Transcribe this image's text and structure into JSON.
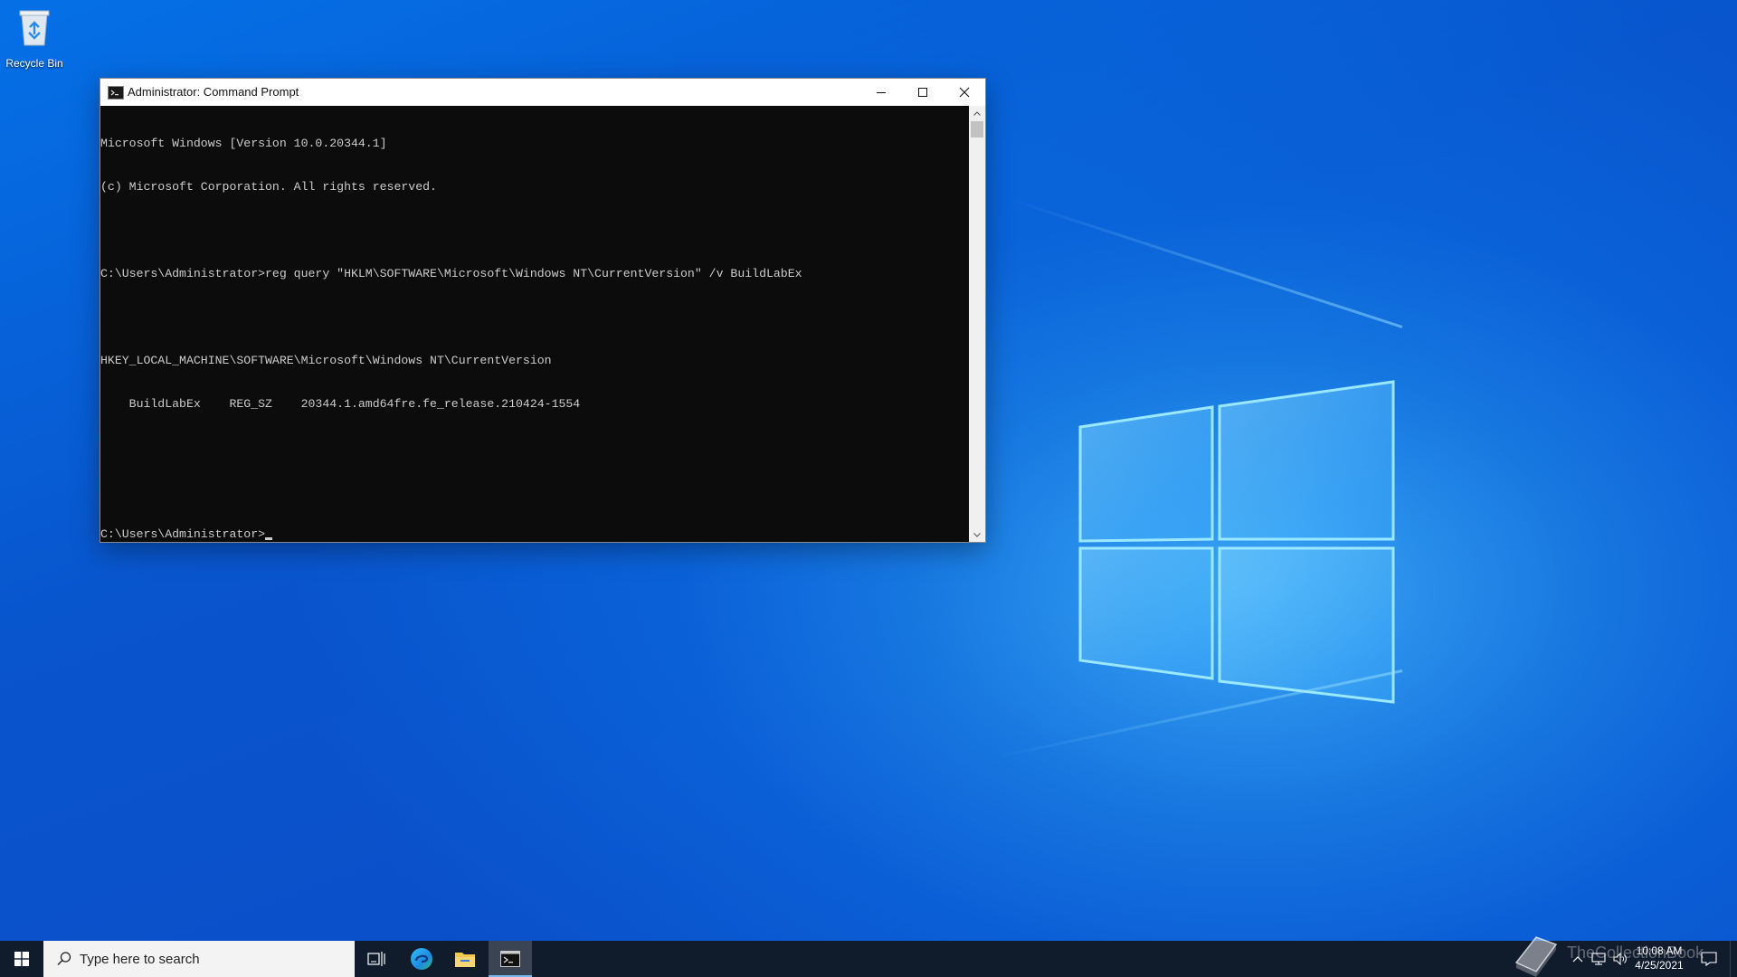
{
  "desktop": {
    "icons": [
      {
        "label": "Recycle Bin",
        "icon": "recycle-bin-icon"
      }
    ]
  },
  "cmd_window": {
    "title": "Administrator: Command Prompt",
    "icon": "command-prompt-icon",
    "controls": {
      "minimize": "minimize-icon",
      "maximize": "maximize-icon",
      "close": "close-icon"
    },
    "console_lines": [
      "Microsoft Windows [Version 10.0.20344.1]",
      "(c) Microsoft Corporation. All rights reserved.",
      "",
      "C:\\Users\\Administrator>reg query \"HKLM\\SOFTWARE\\Microsoft\\Windows NT\\CurrentVersion\" /v BuildLabEx",
      "",
      "HKEY_LOCAL_MACHINE\\SOFTWARE\\Microsoft\\Windows NT\\CurrentVersion",
      "    BuildLabEx    REG_SZ    20344.1.amd64fre.fe_release.210424-1554",
      "",
      ""
    ],
    "prompt": "C:\\Users\\Administrator>"
  },
  "taskbar": {
    "start_icon": "windows-start-icon",
    "search_placeholder": "Type here to search",
    "pinned": [
      {
        "name": "task-view",
        "icon": "task-view-icon"
      },
      {
        "name": "edge",
        "icon": "edge-browser-icon"
      },
      {
        "name": "file-explorer",
        "icon": "folder-icon"
      },
      {
        "name": "command-prompt",
        "icon": "command-prompt-icon",
        "active": true
      }
    ],
    "tray_icons": [
      "chevron-up-icon",
      "network-icon",
      "volume-icon"
    ],
    "clock": {
      "time": "10:08 AM",
      "date": "4/25/2021"
    },
    "notification_icon": "notification-icon"
  },
  "watermark": {
    "text": "TheCollectionBook",
    "icon": "book-icon"
  },
  "colors": {
    "console_bg": "#0c0c0c",
    "console_fg": "#cccccc",
    "taskbar_bg": "#101b2c",
    "desktop_blue": "#0b5fd6"
  }
}
